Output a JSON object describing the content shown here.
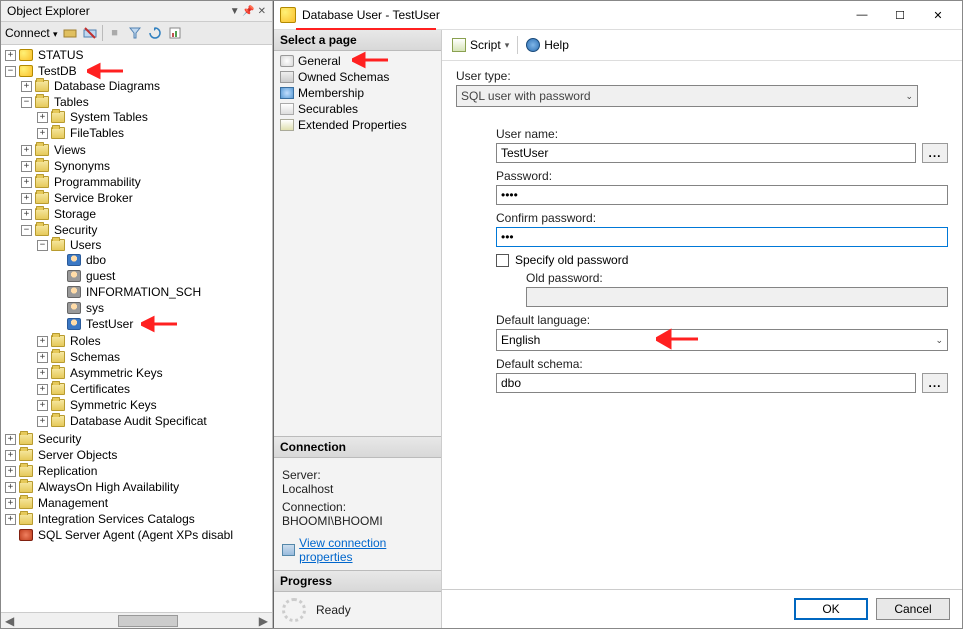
{
  "explorer": {
    "title": "Object Explorer",
    "connect_label": "Connect",
    "tree": {
      "status": "STATUS",
      "testdb": "TestDB",
      "db_diagrams": "Database Diagrams",
      "tables": "Tables",
      "system_tables": "System Tables",
      "file_tables": "FileTables",
      "views": "Views",
      "synonyms": "Synonyms",
      "programmability": "Programmability",
      "service_broker": "Service Broker",
      "storage": "Storage",
      "security_db": "Security",
      "users": "Users",
      "user_dbo": "dbo",
      "user_guest": "guest",
      "user_info": "INFORMATION_SCH",
      "user_sys": "sys",
      "user_test": "TestUser",
      "roles": "Roles",
      "schemas": "Schemas",
      "asym_keys": "Asymmetric Keys",
      "certs": "Certificates",
      "sym_keys": "Symmetric Keys",
      "audit": "Database Audit Specificat",
      "security_root": "Security",
      "server_objects": "Server Objects",
      "replication": "Replication",
      "alwayson": "AlwaysOn High Availability",
      "management": "Management",
      "isc": "Integration Services Catalogs",
      "agent": "SQL Server Agent (Agent XPs disabl"
    }
  },
  "dialog": {
    "title": "Database User - TestUser",
    "pages_header": "Select a page",
    "pages": {
      "general": "General",
      "owned": "Owned Schemas",
      "membership": "Membership",
      "securables": "Securables",
      "extended": "Extended Properties"
    },
    "connection": {
      "header": "Connection",
      "server_label": "Server:",
      "server_value": "Localhost",
      "conn_label": "Connection:",
      "conn_value": "BHOOMI\\BHOOMI",
      "view_props": "View connection properties"
    },
    "progress": {
      "header": "Progress",
      "status": "Ready"
    },
    "toolbar": {
      "script": "Script",
      "help": "Help"
    },
    "form": {
      "user_type_label": "User type:",
      "user_type_value": "SQL user with password",
      "user_name_label": "User name:",
      "user_name_value": "TestUser",
      "password_label": "Password:",
      "password_value": "••••",
      "confirm_label": "Confirm password:",
      "confirm_value": "•••",
      "specify_old": "Specify old password",
      "old_password_label": "Old password:",
      "old_password_value": "",
      "default_lang_label": "Default language:",
      "default_lang_value": "English",
      "default_schema_label": "Default schema:",
      "default_schema_value": "dbo",
      "dots": "..."
    },
    "buttons": {
      "ok": "OK",
      "cancel": "Cancel"
    }
  }
}
